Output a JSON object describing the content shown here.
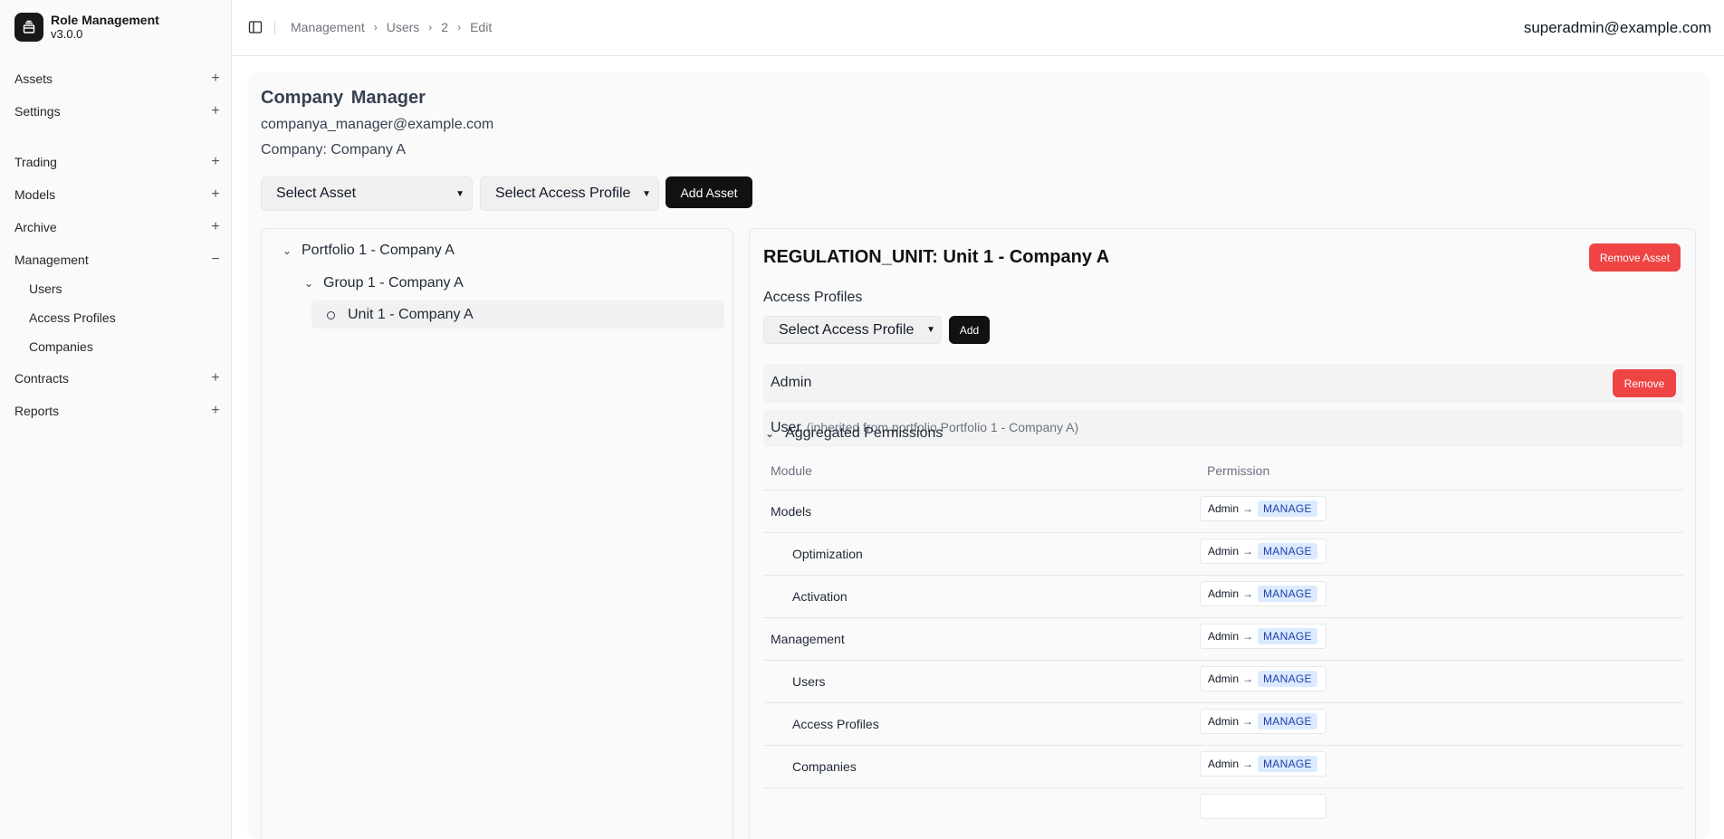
{
  "app": {
    "name": "Role Management",
    "version": "v3.0.0"
  },
  "sidebar": {
    "items": [
      {
        "label": "Assets",
        "sign": "+"
      },
      {
        "label": "Settings",
        "sign": "+"
      },
      {
        "label": "Trading",
        "sign": "+"
      },
      {
        "label": "Models",
        "sign": "+"
      },
      {
        "label": "Archive",
        "sign": "+"
      },
      {
        "label": "Management",
        "sign": "−"
      },
      {
        "label": "Contracts",
        "sign": "+"
      },
      {
        "label": "Reports",
        "sign": "+"
      }
    ],
    "management_sub": [
      "Users",
      "Access Profiles",
      "Companies"
    ]
  },
  "header": {
    "breadcrumb": [
      "Management",
      "Users",
      "2",
      "Edit"
    ],
    "user_email": "superadmin@example.com"
  },
  "user": {
    "first_name": "Company",
    "last_name": "Manager",
    "email": "companya_manager@example.com",
    "company": "Company: Company A"
  },
  "controls": {
    "select_asset": "Select Asset",
    "select_access_profile": "Select Access Profile",
    "add_asset": "Add Asset"
  },
  "tree": {
    "portfolio": "Portfolio 1 - Company A",
    "group": "Group 1 - Company A",
    "unit": "Unit 1 - Company A"
  },
  "detail": {
    "title": "REGULATION_UNIT: Unit 1 - Company A",
    "remove_asset": "Remove Asset",
    "access_profiles_label": "Access Profiles",
    "select_access_profile": "Select Access Profile",
    "add": "Add",
    "profiles": [
      {
        "name": "Admin",
        "remove": "Remove"
      },
      {
        "name": "User",
        "note": "(inherited from portfolio Portfolio 1 - Company A)"
      }
    ],
    "aggregated_label": "Aggregated Permissions",
    "columns": {
      "module": "Module",
      "permission": "Permission"
    },
    "rows": [
      {
        "module": "Models",
        "source": "Admin",
        "arrow": "→",
        "level": "MANAGE"
      },
      {
        "module": "Optimization",
        "source": "Admin",
        "arrow": "→",
        "level": "MANAGE"
      },
      {
        "module": "Activation",
        "source": "Admin",
        "arrow": "→",
        "level": "MANAGE"
      },
      {
        "module": "Management",
        "source": "Admin",
        "arrow": "→",
        "level": "MANAGE"
      },
      {
        "module": "Users",
        "source": "Admin",
        "arrow": "→",
        "level": "MANAGE"
      },
      {
        "module": "Access Profiles",
        "source": "Admin",
        "arrow": "→",
        "level": "MANAGE"
      },
      {
        "module": "Companies",
        "source": "Admin",
        "arrow": "→",
        "level": "MANAGE"
      }
    ]
  }
}
